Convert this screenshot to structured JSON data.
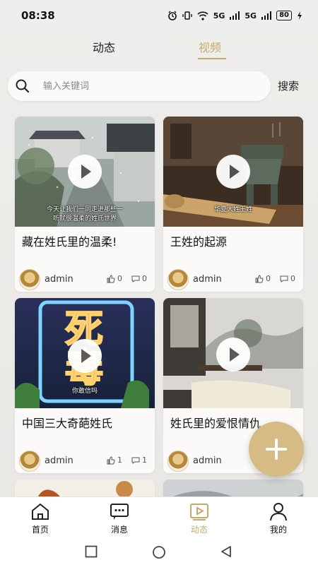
{
  "status_bar": {
    "time": "08:38",
    "signal1": "5G",
    "signal2": "5G",
    "battery": "80"
  },
  "top_tabs": [
    {
      "label": "动态",
      "active": false
    },
    {
      "label": "视频",
      "active": true
    }
  ],
  "search": {
    "placeholder": "输入关键词",
    "button_label": "搜索"
  },
  "cards": [
    {
      "title": "藏在姓氏里的温柔!",
      "caption_line1": "今天让我们一同走进那些一",
      "caption_line2": "听就很温柔的姓氏世界",
      "author": "admin",
      "likes": "0",
      "comments": "0"
    },
    {
      "title": "王姓的起源",
      "caption_line1": "华夏大姓王姓",
      "caption_line2": "",
      "author": "admin",
      "likes": "0",
      "comments": "0"
    },
    {
      "title": "中国三大奇葩姓氏",
      "caption_line1": "你敢信吗",
      "caption_line2": "",
      "author": "admin",
      "likes": "1",
      "comments": "1"
    },
    {
      "title": "姓氏里的爱恨情仇",
      "caption_line1": "",
      "caption_line2": "",
      "author": "admin",
      "likes": "",
      "comments": ""
    }
  ],
  "thumb3_text": {
    "line1": "死",
    "line2": "毒"
  },
  "bottom_nav": [
    {
      "label": "首页",
      "icon": "home-icon"
    },
    {
      "label": "消息",
      "icon": "message-icon"
    },
    {
      "label": "动态",
      "icon": "video-icon",
      "active": true
    },
    {
      "label": "我的",
      "icon": "profile-icon"
    }
  ],
  "colors": {
    "accent": "#c9a86a",
    "fab": "#d7bb85"
  }
}
